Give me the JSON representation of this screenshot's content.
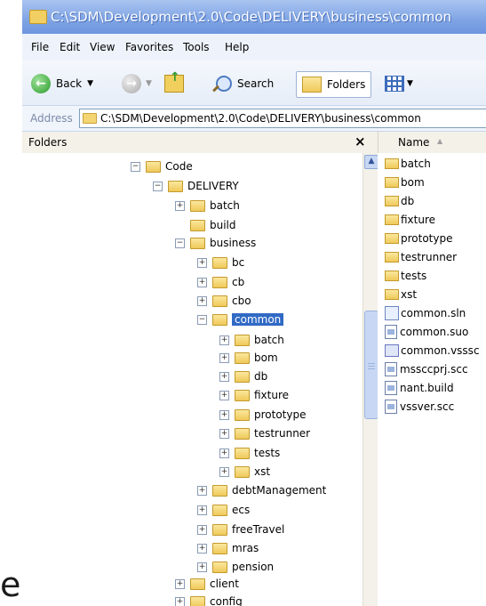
{
  "window": {
    "title": "C:\\SDM\\Development\\2.0\\Code\\DELIVERY\\business\\common"
  },
  "menu": [
    "File",
    "Edit",
    "View",
    "Favorites",
    "Tools",
    "Help"
  ],
  "toolbar": {
    "back_label": "Back",
    "search_label": "Search",
    "folders_label": "Folders"
  },
  "address": {
    "label": "Address",
    "value": "C:\\SDM\\Development\\2.0\\Code\\DELIVERY\\business\\common"
  },
  "folders_pane": {
    "title": "Folders",
    "close": "×"
  },
  "tree": [
    {
      "label": "Code",
      "expander": "−"
    },
    {
      "label": "DELIVERY",
      "expander": "−"
    },
    {
      "label": "batch",
      "expander": "+"
    },
    {
      "label": "build",
      "expander": ""
    },
    {
      "label": "business",
      "expander": "−"
    },
    {
      "label": "bc",
      "expander": "+"
    },
    {
      "label": "cb",
      "expander": "+"
    },
    {
      "label": "cbo",
      "expander": "+"
    },
    {
      "label": "common",
      "expander": "−",
      "selected": true
    },
    {
      "label": "batch",
      "expander": "+"
    },
    {
      "label": "bom",
      "expander": "+"
    },
    {
      "label": "db",
      "expander": "+"
    },
    {
      "label": "fixture",
      "expander": "+"
    },
    {
      "label": "prototype",
      "expander": "+"
    },
    {
      "label": "testrunner",
      "expander": "+"
    },
    {
      "label": "tests",
      "expander": "+"
    },
    {
      "label": "xst",
      "expander": "+"
    },
    {
      "label": "debtManagement",
      "expander": "+"
    },
    {
      "label": "ecs",
      "expander": "+"
    },
    {
      "label": "freeTravel",
      "expander": "+"
    },
    {
      "label": "mras",
      "expander": "+"
    },
    {
      "label": "pension",
      "expander": "+"
    },
    {
      "label": "client",
      "expander": "+"
    },
    {
      "label": "config",
      "expander": "+"
    }
  ],
  "list": {
    "column": "Name",
    "items": [
      {
        "name": "batch",
        "kind": "folder"
      },
      {
        "name": "bom",
        "kind": "folder"
      },
      {
        "name": "db",
        "kind": "folder"
      },
      {
        "name": "fixture",
        "kind": "folder"
      },
      {
        "name": "prototype",
        "kind": "folder"
      },
      {
        "name": "testrunner",
        "kind": "folder"
      },
      {
        "name": "tests",
        "kind": "folder"
      },
      {
        "name": "xst",
        "kind": "folder"
      },
      {
        "name": "common.sln",
        "kind": "sln"
      },
      {
        "name": "common.suo",
        "kind": "doc"
      },
      {
        "name": "common.vsssc",
        "kind": "vss"
      },
      {
        "name": "mssccprj.scc",
        "kind": "doc"
      },
      {
        "name": "nant.build",
        "kind": "doc"
      },
      {
        "name": "vssver.scc",
        "kind": "doc"
      }
    ]
  },
  "overlay_glyph": "e"
}
